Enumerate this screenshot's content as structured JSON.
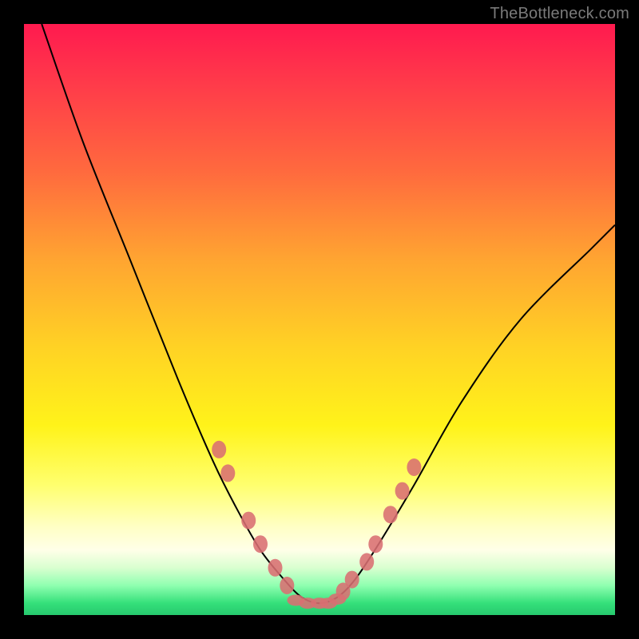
{
  "watermark": "TheBottleneck.com",
  "chart_data": {
    "type": "line",
    "title": "",
    "xlabel": "",
    "ylabel": "",
    "xlim": [
      0,
      100
    ],
    "ylim": [
      0,
      100
    ],
    "grid": false,
    "series": [
      {
        "name": "curve",
        "x": [
          3,
          10,
          18,
          26,
          32,
          36,
          40,
          44,
          47,
          50,
          53,
          56,
          60,
          66,
          74,
          84,
          96,
          100
        ],
        "y": [
          100,
          80,
          60,
          40,
          26,
          18,
          11,
          6,
          3,
          2,
          3,
          6,
          12,
          22,
          36,
          50,
          62,
          66
        ]
      }
    ],
    "markers": {
      "left_branch": [
        {
          "x": 33,
          "y": 28
        },
        {
          "x": 34.5,
          "y": 24
        },
        {
          "x": 38,
          "y": 16
        },
        {
          "x": 40,
          "y": 12
        },
        {
          "x": 42.5,
          "y": 8
        },
        {
          "x": 44.5,
          "y": 5
        }
      ],
      "right_branch": [
        {
          "x": 54,
          "y": 4
        },
        {
          "x": 55.5,
          "y": 6
        },
        {
          "x": 58,
          "y": 9
        },
        {
          "x": 59.5,
          "y": 12
        },
        {
          "x": 62,
          "y": 17
        },
        {
          "x": 64,
          "y": 21
        },
        {
          "x": 66,
          "y": 25
        }
      ],
      "trough": [
        {
          "x": 46,
          "y": 2.5
        },
        {
          "x": 48,
          "y": 2
        },
        {
          "x": 50,
          "y": 2
        },
        {
          "x": 51.5,
          "y": 2
        },
        {
          "x": 53,
          "y": 2.7
        }
      ]
    },
    "marker_radius_px": 9
  }
}
